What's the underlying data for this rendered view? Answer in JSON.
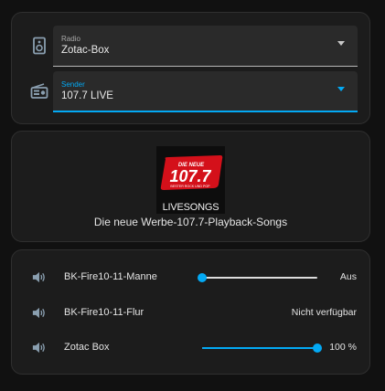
{
  "colors": {
    "accent": "#03a9f4",
    "card_bg": "#1c1c1c",
    "page_bg": "#111111",
    "icon": "#8a9fb0"
  },
  "selectors": [
    {
      "icon": "speaker-icon",
      "label": "Radio",
      "value": "Zotac-Box",
      "active": false
    },
    {
      "icon": "radio-icon",
      "label": "Sender",
      "value": "107.7 LIVE",
      "active": true
    }
  ],
  "media": {
    "logo": {
      "top_text": "DIE NEUE",
      "number": "107.7",
      "tagline": "BESTER ROCK UND POP",
      "caption": "LIVESONGS"
    },
    "title": "Die neue Werbe-107.7-Playback-Songs"
  },
  "volume": [
    {
      "icon": "volume-icon",
      "name": "BK-Fire10-11-Manne",
      "has_slider": true,
      "level": 0.0,
      "state": "Aus"
    },
    {
      "icon": "volume-icon",
      "name": "BK-Fire10-11-Flur",
      "has_slider": false,
      "level": null,
      "state": "Nicht verfügbar"
    },
    {
      "icon": "volume-icon",
      "name": "Zotac Box",
      "has_slider": true,
      "level": 1.0,
      "state": "100 %"
    }
  ]
}
